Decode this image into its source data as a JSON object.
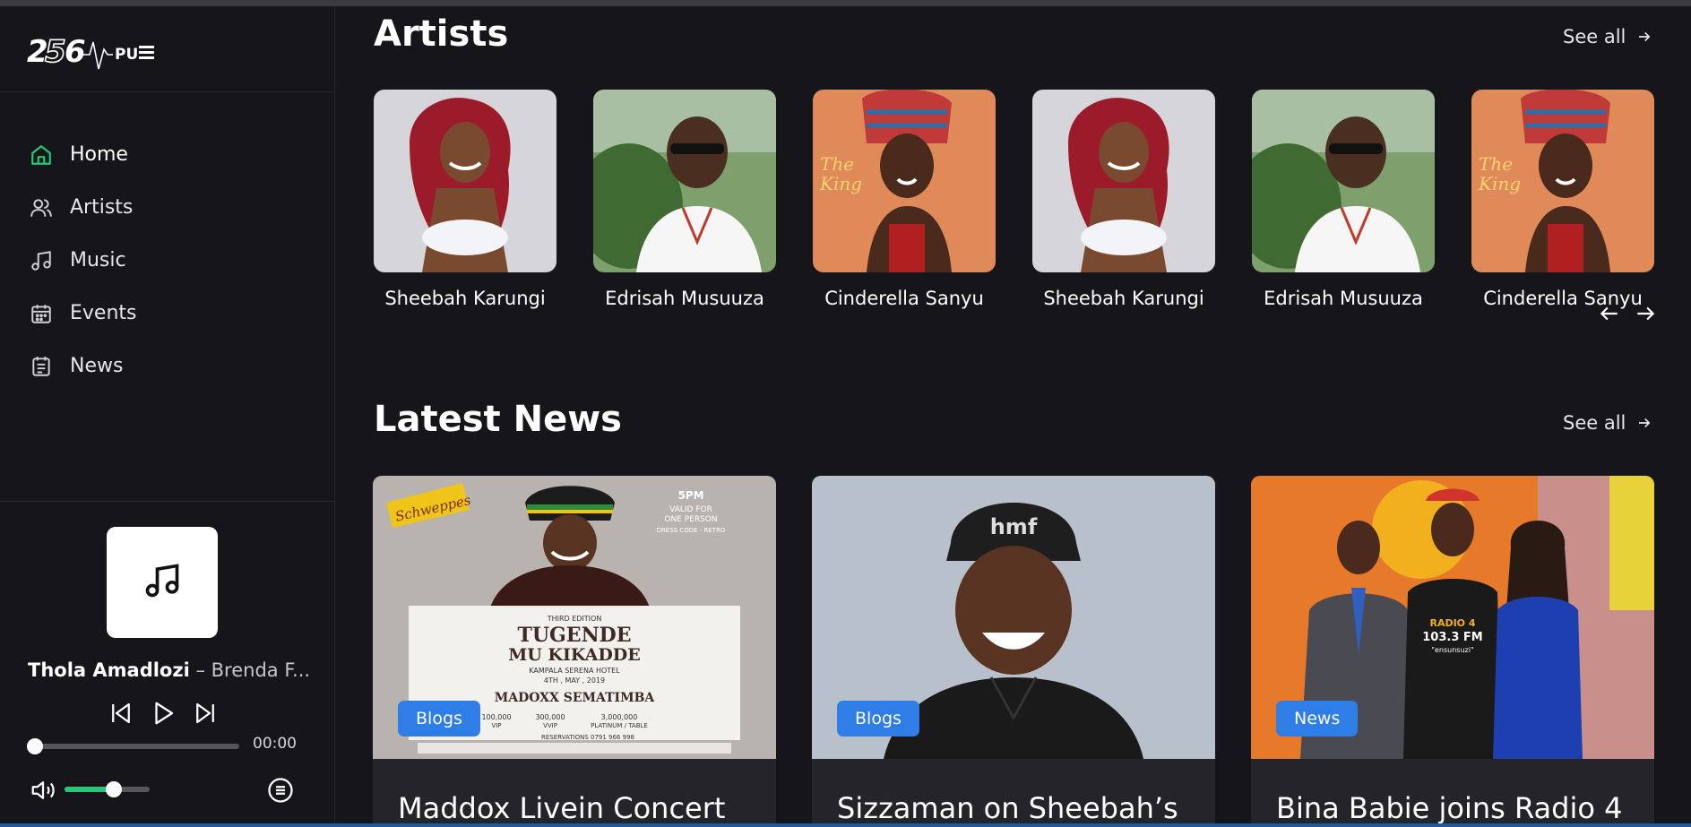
{
  "brand": {
    "logo_text": "256PULSE"
  },
  "nav": {
    "items": [
      {
        "label": "Home",
        "icon": "home-icon",
        "active": true
      },
      {
        "label": "Artists",
        "icon": "users-icon",
        "active": false
      },
      {
        "label": "Music",
        "icon": "music-note-icon",
        "active": false
      },
      {
        "label": "Events",
        "icon": "calendar-icon",
        "active": false
      },
      {
        "label": "News",
        "icon": "newspaper-icon",
        "active": false
      }
    ]
  },
  "player": {
    "track_title": "Thola Amadlozi",
    "separator": " – ",
    "artist": "Brenda F...",
    "time": "00:00",
    "progress": 0,
    "volume": 0.58,
    "controls": [
      "previous-icon",
      "play-icon",
      "next-icon"
    ]
  },
  "artists": {
    "title": "Artists",
    "see_all": "See all",
    "items": [
      {
        "name": "Sheebah Karungi"
      },
      {
        "name": "Edrisah Musuuza"
      },
      {
        "name": "Cinderella Sanyu"
      },
      {
        "name": "Sheebah Karungi"
      },
      {
        "name": "Edrisah Musuuza"
      },
      {
        "name": "Cinderella Sanyu"
      }
    ]
  },
  "news": {
    "title": "Latest News",
    "see_all": "See all",
    "items": [
      {
        "badge": "Blogs",
        "title": "Maddox Livein Concert"
      },
      {
        "badge": "Blogs",
        "title": "Sizzaman on Sheebah’s"
      },
      {
        "badge": "News",
        "title": "Bina Babie joins Radio 4"
      }
    ],
    "poster": {
      "brand": "Schweppes",
      "time": "5PM",
      "valid": "VALID FOR",
      "person": "ONE PERSON",
      "dress": "DRESS CODE - RETRO",
      "edition": "THIRD EDITION",
      "line1": "TUGENDE",
      "line2": "MU KIKADDE",
      "venue": "KAMPALA SERENA HOTEL",
      "date": "4TH , MAY , 2019",
      "act": "MADOXX SEMATIMBA",
      "p1": "100,000",
      "p1l": "VIP",
      "p2": "300,000",
      "p2l": "VVIP",
      "p3": "3,000,000",
      "p3l": "PLATINUM / TABLE",
      "reservations": "RESERVATIONS 0791 966 998"
    },
    "cap_text": "hmf",
    "radio": {
      "station": "RADIO 4",
      "freq": "103.3 FM",
      "tag": "\"ensunsuzi\""
    }
  },
  "colors": {
    "bg": "#16161a",
    "accent_green": "#27c77a",
    "badge_blue": "#2f7de6",
    "card": "#24242a"
  }
}
